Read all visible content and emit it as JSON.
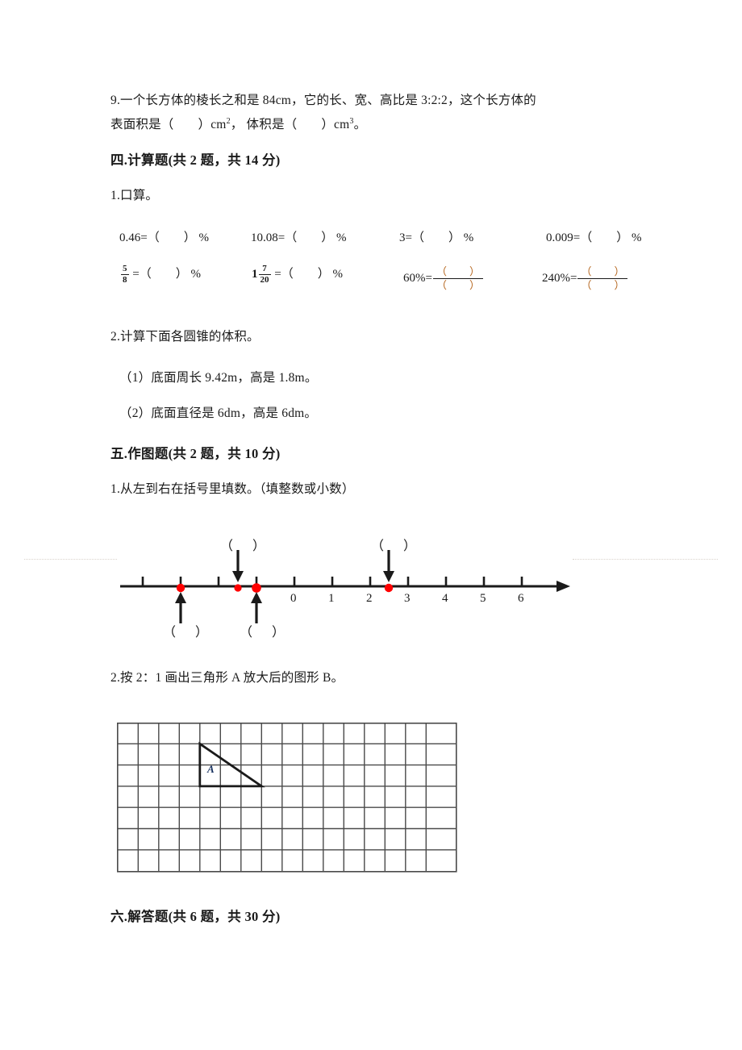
{
  "document": {
    "type": "math-worksheet",
    "language": "zh-CN"
  },
  "fill_blank_last": {
    "number": "9.",
    "line1": "一个长方体的棱长之和是 84cm，它的长、宽、高比是 3:2:2，这个长方体的",
    "line2_a": "表面积是（",
    "line2_b": "）cm",
    "line2_sup1": "2",
    "line2_c": "，   体积是（",
    "line2_d": "）cm",
    "line2_sup2": "3",
    "line2_e": "。"
  },
  "section_four": {
    "heading": "四.计算题(共 2 题，共 14 分)",
    "q1_label": "1.口算。",
    "row1": [
      {
        "lhs": "0.46=",
        "mid": "（",
        "close": "）",
        "unit": "%"
      },
      {
        "lhs": "10.08=",
        "mid": "（",
        "close": "）",
        "unit": "%"
      },
      {
        "lhs": "3=",
        "mid": "（",
        "close": "）",
        "unit": "%"
      },
      {
        "lhs": "0.009=",
        "mid": "（",
        "close": "）",
        "unit": "%"
      }
    ],
    "row2": [
      {
        "kind": "fraction",
        "whole": "",
        "num": "5",
        "den": "8",
        "eq": "=",
        "mid": "（",
        "close": "）",
        "unit": "%"
      },
      {
        "kind": "fraction",
        "whole": "1",
        "num": "7",
        "den": "20",
        "eq": "=",
        "mid": "（",
        "close": "）",
        "unit": "%"
      },
      {
        "kind": "percent-to-fraction",
        "lhs": "60%",
        "eq": "=",
        "num_open": "（",
        "num_close": "）",
        "den_open": "（",
        "den_close": "）"
      },
      {
        "kind": "percent-to-fraction",
        "lhs": "240%",
        "eq": "=",
        "num_open": "（",
        "num_close": "）",
        "den_open": "（",
        "den_close": "）"
      }
    ],
    "q2_label": "2.计算下面各圆锥的体积。",
    "q2_items": [
      "（1）底面周长 9.42m，高是 1.8m。",
      "（2）底面直径是 6dm，高是 6dm。"
    ]
  },
  "section_five": {
    "heading": "五.作图题(共 2 题，共 10 分)",
    "q1_label": "1.从左到右在括号里填数。（填整数或小数）",
    "numberline": {
      "axis_labels": [
        "0",
        "1",
        "2",
        "3",
        "4",
        "5",
        "6"
      ],
      "axis_label_values": [
        0,
        1,
        2,
        3,
        4,
        5,
        6
      ],
      "tick_count": 12,
      "arrow_direction": "right",
      "marked_points": [
        {
          "id": "p1",
          "value": -4,
          "arrow": "up",
          "paren_position": "below",
          "paren_open": "（",
          "paren_close": "）",
          "dot_color": "#ff0000"
        },
        {
          "id": "p2",
          "value": -2.5,
          "arrow": "down",
          "paren_position": "above",
          "paren_open": "（",
          "paren_close": "）",
          "dot_color": "#ff0000"
        },
        {
          "id": "p3",
          "value": -2,
          "arrow": "up",
          "paren_position": "below",
          "paren_open": "（",
          "paren_close": "）",
          "dot_color": "#ff0000"
        },
        {
          "id": "p4",
          "value": 2.5,
          "arrow": "down",
          "paren_position": "above",
          "paren_open": "（",
          "paren_close": "）",
          "dot_color": "#ff0000"
        }
      ]
    },
    "q2_label": "2.按 2：1 画出三角形 A 放大后的图形 B。",
    "grid": {
      "cols": 16,
      "rows": 7,
      "triangle_label": "A",
      "triangle_vertices_cells": [
        [
          4,
          1
        ],
        [
          4,
          3
        ],
        [
          7,
          3
        ]
      ]
    }
  },
  "section_six": {
    "heading": "六.解答题(共 6 题，共 30 分)"
  },
  "colors": {
    "ink": "#1a1a1a",
    "point_red": "#ff0000",
    "fraction_paren": "#b5651d",
    "grid_line": "#4a4a4a",
    "label_blue": "#16305f"
  }
}
